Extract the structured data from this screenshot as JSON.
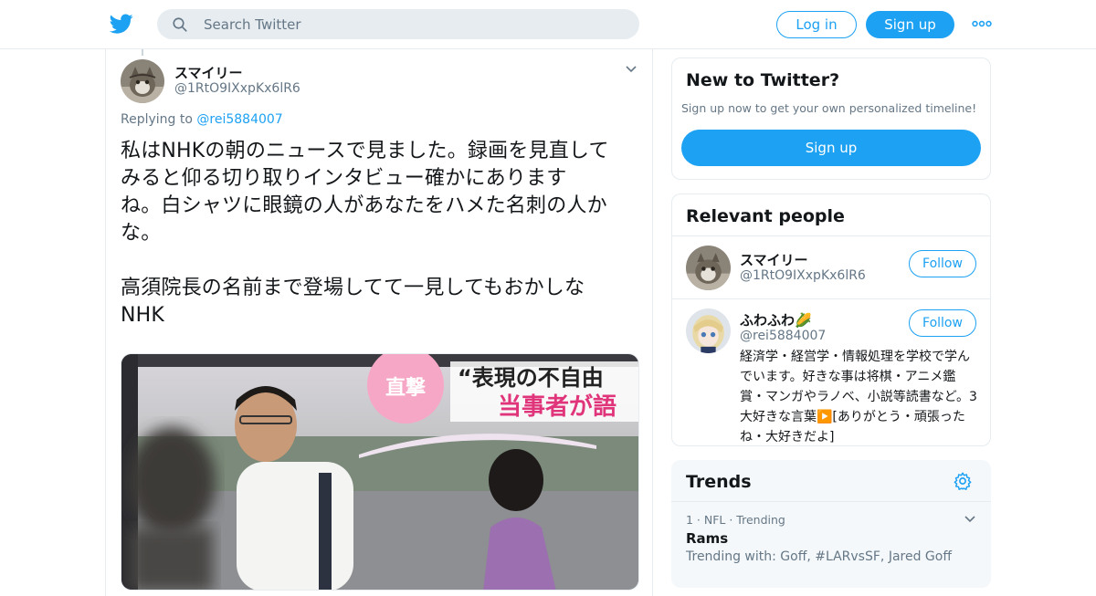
{
  "nav": {
    "search_placeholder": "Search Twitter",
    "login_label": "Log in",
    "signup_label": "Sign up",
    "icons": {
      "logo": "twitter-bird-icon",
      "search": "search-icon",
      "more": "more-dots-icon"
    }
  },
  "tweet": {
    "author_name": "スマイリー",
    "author_handle": "@1RtO9IXxpKx6lR6",
    "replying_prefix": "Replying to ",
    "replying_to": "@rei5884007",
    "text": "私はNHKの朝のニュースで見ました。録画を見直して\nみると仰る切り取りインタビュー確かにあります\nね。白シャツに眼鏡の人があなたをハメた名刺の人か\nな。\n\n高須院長の名前まで登場してて一見してもおかしな\nNHK",
    "media": {
      "badge_text": "直撃",
      "caption_line1": "“表現の不自由",
      "caption_line2": "当事者が語"
    }
  },
  "sidebar": {
    "new_to_twitter": {
      "title": "New to Twitter?",
      "subtitle": "Sign up now to get your own personalized timeline!",
      "button": "Sign up"
    },
    "relevant_people": {
      "title": "Relevant people",
      "people": [
        {
          "name": "スマイリー",
          "handle": "@1RtO9IXxpKx6lR6",
          "follow_label": "Follow"
        },
        {
          "name": "ふわふわ🌽",
          "handle": "@rei5884007",
          "follow_label": "Follow",
          "bio": "経済学・経営学・情報処理を学校で学んでいます。好きな事は将棋・アニメ鑑賞・マンガやラノベ、小説等読書など。3大好きな言葉▶️[ありがとう・頑張ったね・大好きだよ]"
        }
      ]
    },
    "trends": {
      "title": "Trends",
      "items": [
        {
          "meta": "1 · NFL · Trending",
          "name": "Rams",
          "trending_with": "Trending with: Goff, #LARvsSF, Jared Goff"
        }
      ]
    }
  },
  "colors": {
    "brand": "#1da1f2",
    "text": "#14171a",
    "muted": "#657786",
    "border": "#e6ecf0"
  }
}
